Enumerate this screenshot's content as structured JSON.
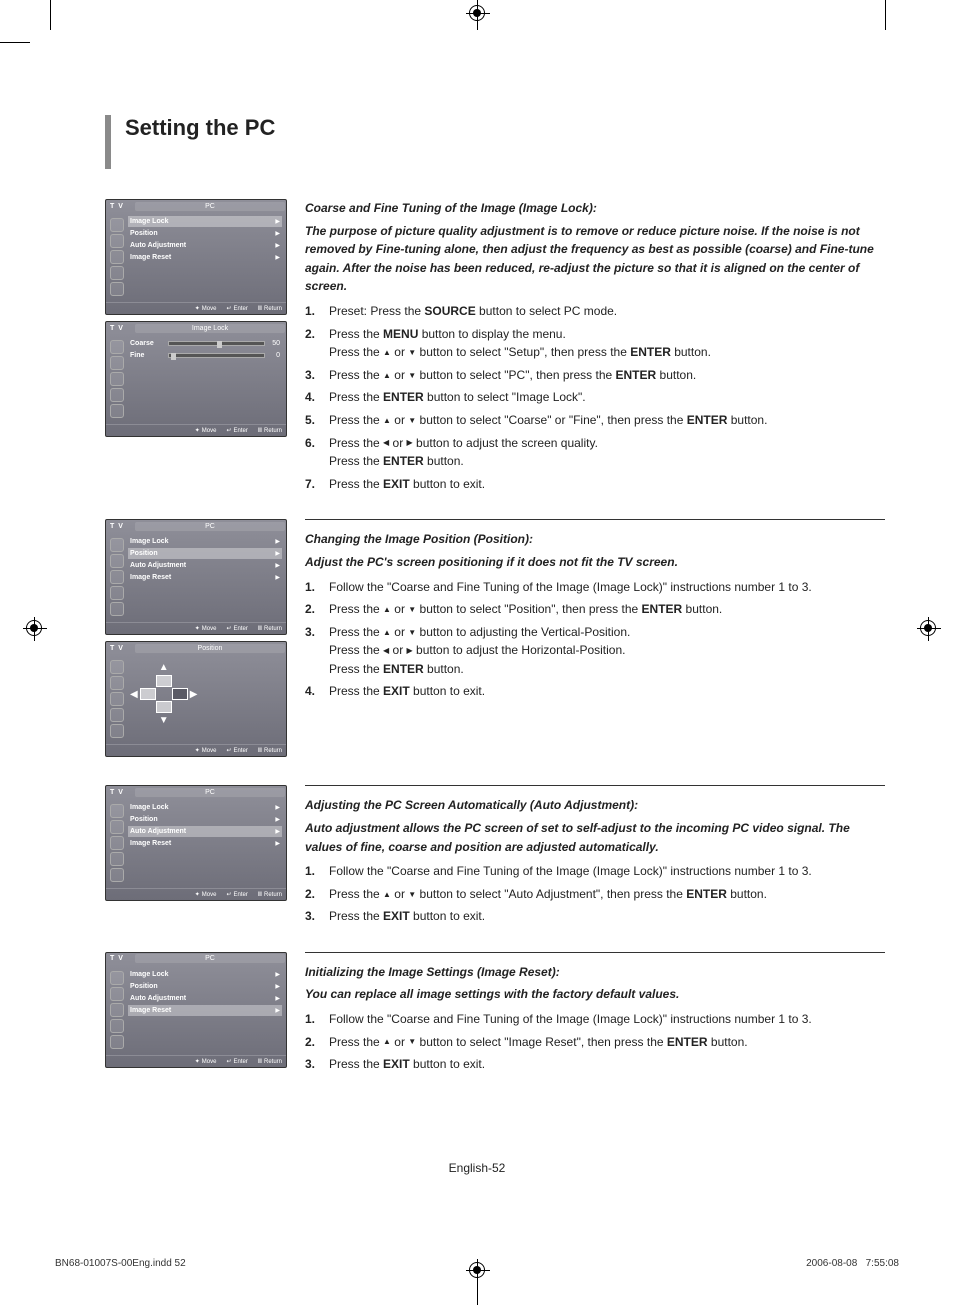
{
  "title": "Setting the PC",
  "menu": {
    "tv_label": "T V",
    "pc_title": "PC",
    "imagelock_title": "Image Lock",
    "position_title": "Position",
    "items": [
      "Image Lock",
      "Position",
      "Auto Adjustment",
      "Image Reset"
    ],
    "coarse": {
      "label": "Coarse",
      "value": "50"
    },
    "fine": {
      "label": "Fine",
      "value": "0"
    },
    "foot_move": "Move",
    "foot_enter": "Enter",
    "foot_return": "Return"
  },
  "sec1": {
    "h": "Coarse and Fine Tuning of the Image (Image Lock):",
    "p": "The purpose of picture quality adjustment is to remove or reduce picture noise. If the noise is not removed by Fine-tuning alone, then adjust the frequency as best as possible (coarse) and Fine-tune again. After the noise has been reduced, re-adjust the picture so that it is aligned on the center of screen.",
    "steps": {
      "s1": {
        "a": "Preset: Press the ",
        "b": "SOURCE",
        "c": " button to select PC mode."
      },
      "s2": {
        "a": "Press the ",
        "b": "MENU",
        "c": " button to display the menu.",
        "d": "Press the ",
        "e": " or ",
        "f": " button to select \"Setup\", then press the ",
        "g": "ENTER",
        "h": " button."
      },
      "s3": {
        "a": "Press the ",
        "b": " or ",
        "c": " button to select \"PC\", then press the ",
        "d": "ENTER",
        "e": " button."
      },
      "s4": {
        "a": "Press the ",
        "b": "ENTER",
        "c": " button to select \"Image Lock\"."
      },
      "s5": {
        "a": "Press the ",
        "b": " or ",
        "c": " button to select \"Coarse\" or \"Fine\", then press the ",
        "d": "ENTER",
        "e": " button."
      },
      "s6": {
        "a": "Press the ",
        "b": " or ",
        "c": " button to adjust the screen quality.",
        "d": "Press the ",
        "e": "ENTER",
        "f": " button."
      },
      "s7": {
        "a": "Press the ",
        "b": "EXIT",
        "c": " button to exit."
      }
    }
  },
  "sec2": {
    "h": "Changing the Image Position (Position):",
    "p": "Adjust the PC's screen positioning if it does not fit the TV screen.",
    "steps": {
      "s1": {
        "a": "Follow the \"Coarse and Fine Tuning of the Image (Image Lock)\" instructions number 1 to 3."
      },
      "s2": {
        "a": "Press the ",
        "b": " or ",
        "c": " button to select \"Position\", then press the ",
        "d": "ENTER",
        "e": " button."
      },
      "s3": {
        "a": "Press the ",
        "b": " or ",
        "c": " button to adjusting the Vertical-Position.",
        "d": "Press the ",
        "e": " or ",
        "f": " button to adjust the Horizontal-Position.",
        "g": "Press the ",
        "h": "ENTER",
        "i": " button."
      },
      "s4": {
        "a": "Press the ",
        "b": "EXIT",
        "c": " button to exit."
      }
    }
  },
  "sec3": {
    "h": "Adjusting the PC Screen Automatically (Auto Adjustment):",
    "p": "Auto adjustment allows the PC screen of set to self-adjust to the incoming PC video signal. The values of fine, coarse and position are adjusted automatically.",
    "steps": {
      "s1": {
        "a": "Follow the \"Coarse and Fine Tuning of the Image (Image Lock)\" instructions number 1 to 3."
      },
      "s2": {
        "a": "Press the ",
        "b": " or ",
        "c": " button to select \"Auto Adjustment\", then press the ",
        "d": "ENTER",
        "e": " button."
      },
      "s3": {
        "a": "Press the ",
        "b": "EXIT",
        "c": " button to exit."
      }
    }
  },
  "sec4": {
    "h": "Initializing the Image Settings (Image Reset):",
    "p": "You can replace all image settings with the factory default values.",
    "steps": {
      "s1": {
        "a": "Follow the \"Coarse and Fine Tuning of the Image (Image Lock)\" instructions number 1 to 3."
      },
      "s2": {
        "a": "Press the ",
        "b": " or ",
        "c": " button to select \"Image Reset\", then press the ",
        "d": "ENTER",
        "e": " button."
      },
      "s3": {
        "a": "Press the ",
        "b": "EXIT",
        "c": " button to exit."
      }
    }
  },
  "footer": {
    "page": "English-52",
    "file": "BN68-01007S-00Eng.indd   52",
    "date": "2006-08-08",
    "time": "7:55:08"
  }
}
